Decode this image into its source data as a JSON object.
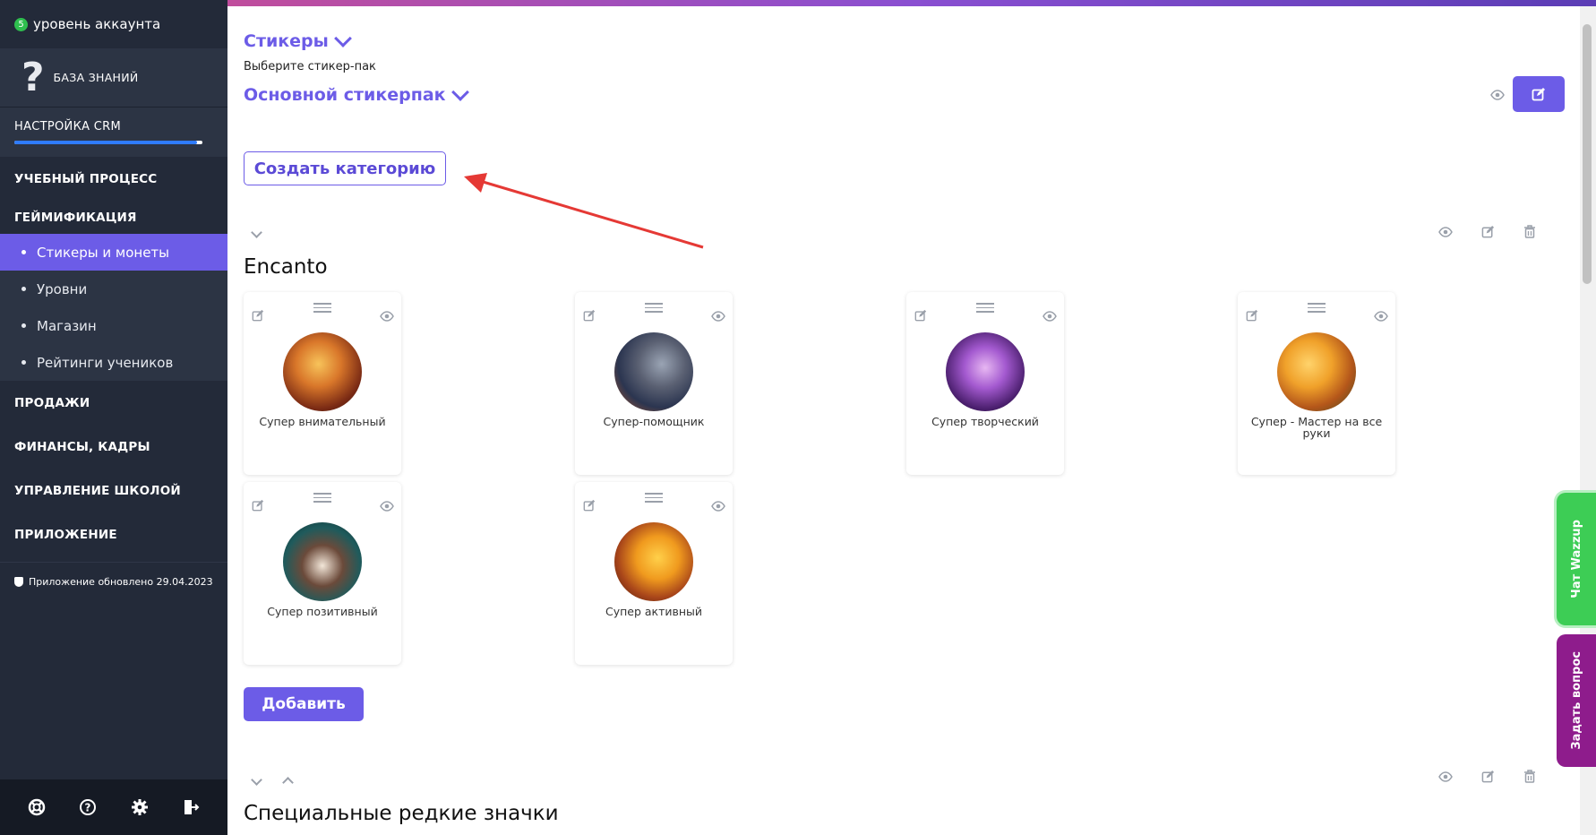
{
  "sidebar": {
    "account_level_number": "5",
    "account_level_label": "уровень аккаунта",
    "knowledge_base": "БАЗА ЗНАНИЙ",
    "crm_setup": {
      "label": "НАСТРОЙКА CRM",
      "progress": 0.97
    },
    "nav": {
      "learning": "УЧЕБНЫЙ ПРОЦЕСС",
      "gamification": "ГЕЙМИФИКАЦИЯ",
      "sales": "ПРОДАЖИ",
      "finance": "ФИНАНСЫ, КАДРЫ",
      "school": "УПРАВЛЕНИЕ ШКОЛОЙ",
      "app": "ПРИЛОЖЕНИЕ"
    },
    "gamification_items": [
      {
        "label": "Стикеры и монеты",
        "active": true
      },
      {
        "label": "Уровни",
        "active": false
      },
      {
        "label": "Магазин",
        "active": false
      },
      {
        "label": "Рейтинги учеников",
        "active": false
      }
    ],
    "updated_note": "Приложение обновлено 29.04.2023",
    "bottom_icons": [
      "lifebuoy-icon",
      "help-icon",
      "settings-gear-icon",
      "logout-icon"
    ]
  },
  "header": {
    "title": "Стикеры",
    "select_label": "Выберите стикер-пак",
    "selected_pack": "Основной стикерпак"
  },
  "actions": {
    "create_category": "Создать категорию",
    "add": "Добавить"
  },
  "categories": [
    {
      "title": "Encanto",
      "stickers": [
        {
          "label": "Супер внимательный"
        },
        {
          "label": "Супер-помощник"
        },
        {
          "label": "Супер творческий"
        },
        {
          "label": "Супер - Мастер на все руки"
        },
        {
          "label": "Супер позитивный"
        },
        {
          "label": "Супер активный"
        }
      ]
    },
    {
      "title": "Специальные редкие значки",
      "stickers": []
    }
  ],
  "side_tabs": {
    "wazzup": "Чат Wazzup",
    "ask": "Задать вопрос"
  },
  "colors": {
    "accent": "#6c5ce7",
    "sidebar_bg": "#232a39",
    "annotation_arrow": "#e53935"
  }
}
